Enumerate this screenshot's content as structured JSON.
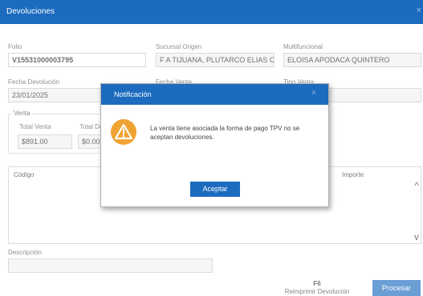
{
  "window": {
    "title": "Devoluciones",
    "close_glyph": "×"
  },
  "form": {
    "folio": {
      "label": "Folio",
      "value": "V15531000003795"
    },
    "sucursal_origen": {
      "label": "Sucursal Origen",
      "value": "F A TIJUANA, PLUTARCO ELIAS CALL"
    },
    "multifuncional": {
      "label": "Multifuncional",
      "value": "ELOISA APODACA QUINTERO"
    },
    "fecha_devolucion": {
      "label": "Fecha Devolución",
      "value": "23/01/2025"
    },
    "fecha_venta": {
      "label": "Fecha Venta",
      "value": ""
    },
    "tipo_venta": {
      "label": "Tipo Venta",
      "value": ""
    },
    "venta_group": {
      "legend": "Venta",
      "total_venta": {
        "label": "Total Venta",
        "value": "$891.00"
      },
      "total_devolucion": {
        "label": "Total De",
        "value": "$0.00"
      }
    },
    "descripcion": {
      "label": "Descripción",
      "value": ""
    }
  },
  "grid": {
    "columns": [
      "Código",
      "Importe"
    ],
    "scroll_up": "^",
    "scroll_down": "v"
  },
  "dialog": {
    "title": "Notificación",
    "close_glyph": "×",
    "icon": "warning-icon",
    "message": "La venta tiene asociada la forma de pago TPV no se aceptan devoluciones.",
    "accept_label": "Aceptar"
  },
  "footer": {
    "reprint_key": "F6",
    "reprint_label": "Reimprimir Devolución",
    "process_label": "Procesar"
  },
  "colors": {
    "accent": "#1c6bbf",
    "warning": "#f0a232"
  }
}
